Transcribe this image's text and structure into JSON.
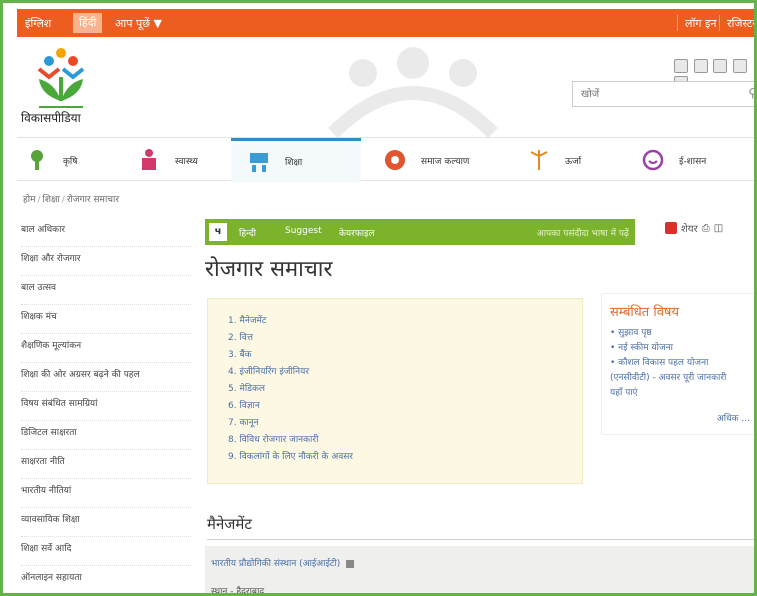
{
  "topbar": {
    "lang_english": "इंग्लिश",
    "lang_hindi": "हिंदी",
    "ask": "आप पूछें ▼",
    "login": "लॉग इन",
    "register": "रजिस्टर"
  },
  "logo_text": "विकासपीडिया",
  "search": {
    "placeholder": "खोजें"
  },
  "nav": [
    {
      "label": "कृषि"
    },
    {
      "label": "स्वास्थ्य"
    },
    {
      "label": "शिक्षा"
    },
    {
      "label": "समाज कल्याण"
    },
    {
      "label": "ऊर्जा"
    },
    {
      "label": "ई-शासन"
    }
  ],
  "breadcrumb": [
    "होम",
    "शिक्षा",
    "रोजगार समाचार"
  ],
  "sidebar": [
    "बाल अधिकार",
    "शिक्षा और रोजगार",
    "बाल उत्सव",
    "शिक्षक मंच",
    "शैक्षणिक मूल्यांकन",
    "शिक्षा की ओर अग्रसर बढ़ने की पहल",
    "विषय संबंधित सामग्रियां",
    "डिजिटल साक्षरता",
    "साक्षरता नीति",
    "भारतीय नीतियां",
    "व्यावसायिक शिक्षा",
    "शिक्षा सर्वे आदि",
    "ऑनलाइन सहायता"
  ],
  "toolbar": {
    "num": "ч",
    "item1": "हिन्दी",
    "item2": "Suggest",
    "item3": "केयरफाइल",
    "right": "आपका पसंदीदा भाषा में पढ़ें"
  },
  "actions": {
    "share": "शेयर"
  },
  "page_title": "रोजगार समाचार",
  "toc": [
    "1. मैनेजमेंट",
    "2. वित्त",
    "3. बैंक",
    "4. इंजीनियरिंग इंजीनियर",
    "5. मेडिकल",
    "6. विज्ञान",
    "7. कानून",
    "8. विविध रोजगार जानकारी",
    "9. विकलांगों के लिए नौकरी के अवसर"
  ],
  "related": {
    "title": "सम्बंधित विषय",
    "items": [
      "• सुझाव पृष्ठ",
      "• नई स्कीम योजना",
      "• कौशल विकास पहल योजना",
      "(एनसीवीटी) - अवसर पूरी जानकारी",
      "यहाँ पाएं"
    ],
    "more": "अधिक ..."
  },
  "section_title": "मैनेजमेंट",
  "listing": {
    "line1": "भारतीय प्रौद्योगिकी संस्थान (आईआईटी)",
    "line2": "स्थान - हैदराबाद"
  },
  "colors": {
    "topbar": "#ec5d1f",
    "toolbar": "#7bb42c",
    "frame": "#63b34a",
    "accent_blue": "#2f8ec6"
  }
}
